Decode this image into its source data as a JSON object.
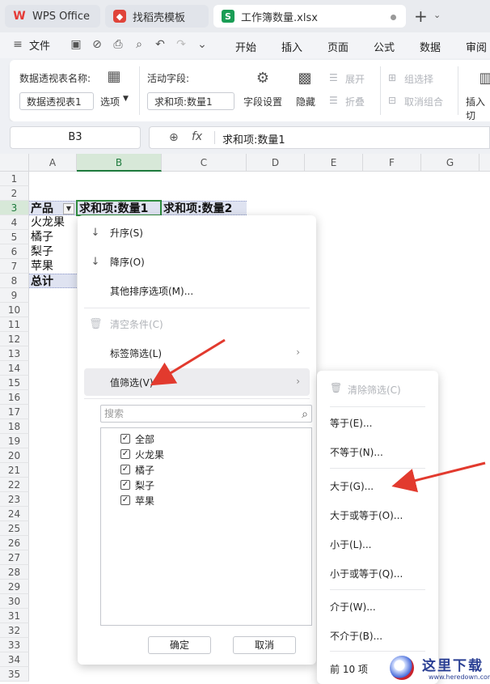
{
  "tabs": [
    {
      "label": "WPS Office"
    },
    {
      "label": "找稻壳模板"
    },
    {
      "label": "工作簿数量.xlsx"
    }
  ],
  "menubar": {
    "file": "文件",
    "items": [
      "开始",
      "插入",
      "页面",
      "公式",
      "数据",
      "审阅"
    ]
  },
  "ribbon": {
    "pivot_name_label": "数据透视表名称:",
    "pivot_name_value": "数据透视表1",
    "options_label": "选项",
    "active_field_label": "活动字段:",
    "active_field_value": "求和项:数量1",
    "field_settings": "字段设置",
    "hide": "隐藏",
    "expand": "展开",
    "collapse": "折叠",
    "group_select": "组选择",
    "ungroup": "取消组合",
    "insert_slicer": "插入切"
  },
  "formula_bar": {
    "name_box": "B3",
    "fx": "fx",
    "formula": "求和项:数量1"
  },
  "sheet": {
    "columns": [
      "A",
      "B",
      "C",
      "D",
      "E",
      "F",
      "G"
    ],
    "rows": [
      "1",
      "2",
      "3",
      "4",
      "5",
      "6",
      "7",
      "8",
      "9",
      "10",
      "11",
      "12",
      "13",
      "14",
      "15",
      "16",
      "17",
      "18",
      "19",
      "20",
      "21",
      "22",
      "23",
      "24",
      "25",
      "26",
      "27",
      "28",
      "29",
      "30",
      "31",
      "32",
      "33",
      "34",
      "35"
    ],
    "a3": "产品",
    "b3": "求和项:数量1",
    "c3": "求和项:数量2",
    "a4": "火龙果",
    "a5": "橘子",
    "a6": "梨子",
    "a7": "苹果",
    "a8": "总计"
  },
  "dropdown": {
    "sort_asc": "升序(S)",
    "sort_desc": "降序(O)",
    "more_sort": "其他排序选项(M)...",
    "clear": "清空条件(C)",
    "label_filter": "标签筛选(L)",
    "value_filter": "值筛选(V)",
    "search_placeholder": "搜索",
    "items": [
      "全部",
      "火龙果",
      "橘子",
      "梨子",
      "苹果"
    ],
    "ok": "确定",
    "cancel": "取消"
  },
  "submenu": {
    "clear_filter": "清除筛选(C)",
    "equals": "等于(E)...",
    "not_equals": "不等于(N)...",
    "greater": "大于(G)...",
    "greater_equal": "大于或等于(O)...",
    "less": "小于(L)...",
    "less_equal": "小于或等于(Q)...",
    "between": "介于(W)...",
    "not_between": "不介于(B)...",
    "top10": "前 10 项"
  },
  "colors": {
    "accent_green": "#1e7a3d",
    "arrow_red": "#e23a2e",
    "pivot_header": "#dfe3f1"
  }
}
